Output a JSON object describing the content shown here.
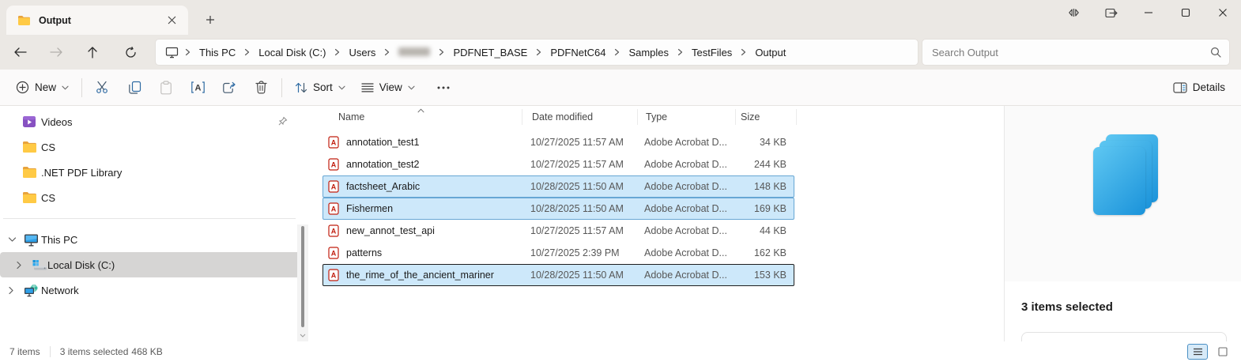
{
  "window": {
    "tab_title": "Output"
  },
  "breadcrumb": {
    "items": [
      "This PC",
      "Local Disk (C:)",
      "Users",
      "PDFNET_BASE",
      "PDFNetC64",
      "Samples",
      "TestFiles",
      "Output"
    ]
  },
  "search": {
    "placeholder": "Search Output"
  },
  "toolbar": {
    "new_label": "New",
    "sort_label": "Sort",
    "view_label": "View",
    "details_label": "Details"
  },
  "sidebar": {
    "pinned_items": [
      {
        "label": "Videos"
      },
      {
        "label": "CS"
      },
      {
        "label": ".NET PDF Library"
      },
      {
        "label": "CS"
      }
    ],
    "tree_items": [
      {
        "label": "This PC"
      },
      {
        "label": "Local Disk (C:)",
        "selected": true
      },
      {
        "label": "Network"
      }
    ]
  },
  "files": {
    "columns": [
      "Name",
      "Date modified",
      "Type",
      "Size"
    ],
    "rows": [
      {
        "name": "annotation_test1",
        "date": "10/27/2025 11:57 AM",
        "type": "Adobe Acrobat D...",
        "size": "34 KB",
        "selected": false
      },
      {
        "name": "annotation_test2",
        "date": "10/27/2025 11:57 AM",
        "type": "Adobe Acrobat D...",
        "size": "244 KB",
        "selected": false
      },
      {
        "name": "factsheet_Arabic",
        "date": "10/28/2025 11:50 AM",
        "type": "Adobe Acrobat D...",
        "size": "148 KB",
        "selected": true
      },
      {
        "name": "Fishermen",
        "date": "10/28/2025 11:50 AM",
        "type": "Adobe Acrobat D...",
        "size": "169 KB",
        "selected": true
      },
      {
        "name": "new_annot_test_api",
        "date": "10/27/2025 11:57 AM",
        "type": "Adobe Acrobat D...",
        "size": "44 KB",
        "selected": false
      },
      {
        "name": "patterns",
        "date": "10/27/2025 2:39 PM",
        "type": "Adobe Acrobat D...",
        "size": "162 KB",
        "selected": false
      },
      {
        "name": "the_rime_of_the_ancient_mariner",
        "date": "10/28/2025 11:50 AM",
        "type": "Adobe Acrobat D...",
        "size": "153 KB",
        "selected": true,
        "focused": true
      }
    ]
  },
  "preview": {
    "selection_text": "3 items selected"
  },
  "statusbar": {
    "items_count": "7 items",
    "selection_count": "3 items selected",
    "selection_size": "468 KB"
  },
  "colors": {
    "accent_blue": "#1b93da",
    "selection_fill": "#cde8fa",
    "selection_border": "#67a7d4",
    "chrome_bg": "#ebe8e4"
  }
}
